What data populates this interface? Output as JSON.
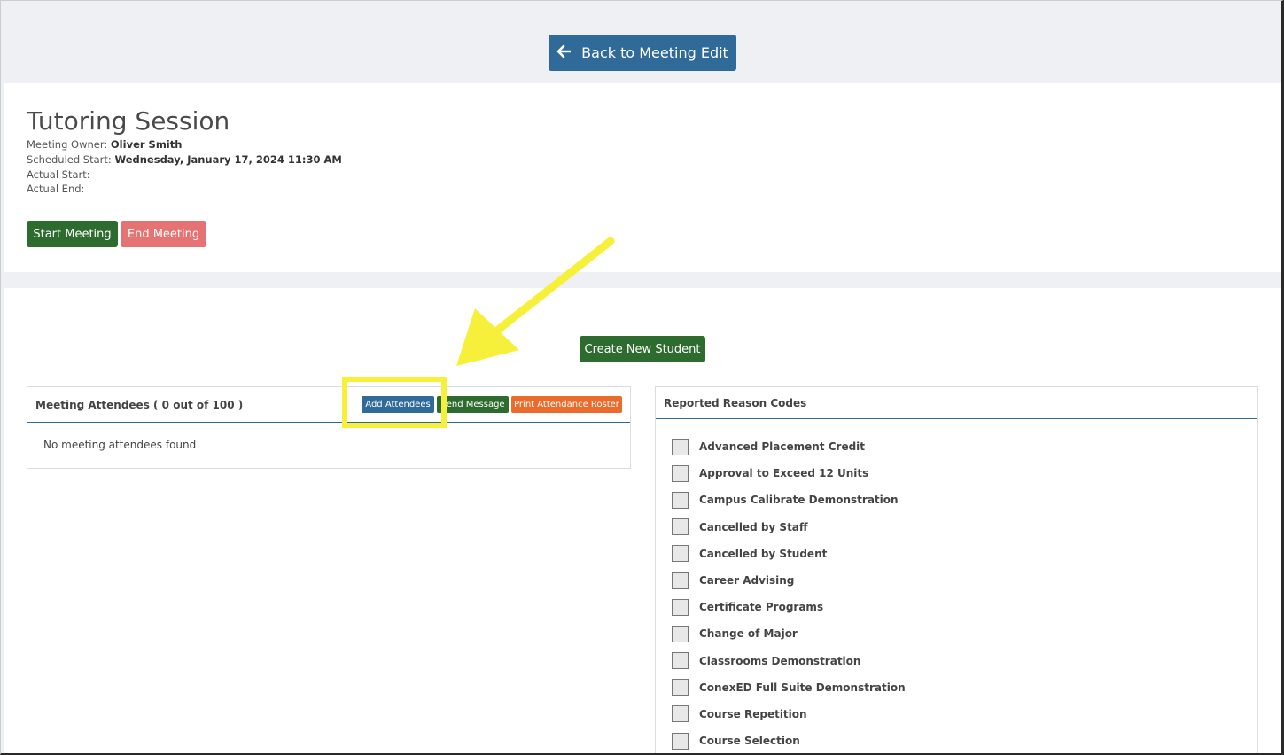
{
  "back_button_label": "Back to Meeting Edit",
  "meeting": {
    "title": "Tutoring Session",
    "owner_label": "Meeting Owner:",
    "owner": "Oliver Smith",
    "scheduled_label": "Scheduled Start:",
    "scheduled": "Wednesday, January 17, 2024 11:30 AM",
    "actual_start_label": "Actual Start:",
    "actual_end_label": "Actual End:",
    "start_button": "Start Meeting",
    "end_button": "End Meeting"
  },
  "create_student_button": "Create New Student",
  "attendees": {
    "title": "Meeting Attendees ( 0 out of 100 )",
    "add_button": "Add Attendees",
    "message_button": "Send Message",
    "print_button": "Print Attendance Roster",
    "empty_text": "No meeting attendees found"
  },
  "reasons": {
    "title": "Reported Reason Codes",
    "items": [
      "Advanced Placement Credit",
      "Approval to Exceed 12 Units",
      "Campus Calibrate Demonstration",
      "Cancelled by Staff",
      "Cancelled by Student",
      "Career Advising",
      "Certificate Programs",
      "Change of Major",
      "Classrooms Demonstration",
      "ConexED Full Suite Demonstration",
      "Course Repetition",
      "Course Selection"
    ]
  },
  "colors": {
    "primary_blue": "#2f6a99",
    "green": "#2e6b2e",
    "red_light": "#e57373",
    "orange": "#ea6b2b",
    "highlight_yellow": "#f7f03a"
  }
}
